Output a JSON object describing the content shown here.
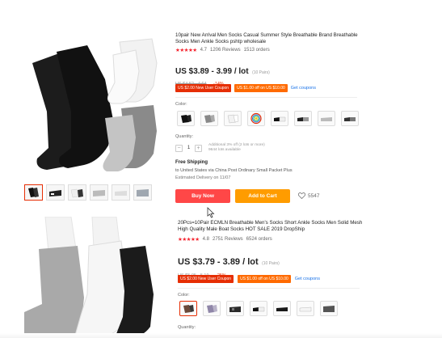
{
  "product1": {
    "title": "10pair New Arrival Men Socks Casual Summer Style Breathable Brand Breathable Socks Men Ankle Socks pshtp wholesale",
    "rating": "4.7",
    "reviews": "1206 Reviews",
    "orders": "1513 orders",
    "price": "US $3.89 - 3.99 / lot",
    "unit_note": "(10 Pairs)",
    "old_price": "US $4.52 - 4.64",
    "discount": "-14%",
    "coupon1": "US $2.00 New User Coupon",
    "coupon2": "US $1.00 off on US $10.00",
    "coupon_link": "Get coupons",
    "color_label": "Color:",
    "quantity_label": "Quantity:",
    "qty_minus": "−",
    "qty_value": "1",
    "qty_plus": "+",
    "qty_note_1": "Additional 3% off (2 lots or more)",
    "qty_note_2": "9644 lots available",
    "shipping_title": "Free Shipping",
    "shipping_text": "to United States via China Post Ordinary Small Packet Plus",
    "delivery": "Estimated Delivery on 11/07",
    "buy_now": "Buy Now",
    "add_to_cart": "Add to Cart",
    "wishlist_count": "5547"
  },
  "product2": {
    "title": "20Pcs=10Pair ECMLN Breathable Men's Socks Short Ankle Socks Men Solid Mesh High Quality Male Boat Socks HOT SALE 2019 DropShip",
    "rating": "4.8",
    "reviews": "2751 Reviews",
    "orders": "6524 orders",
    "price": "US $3.79 - 3.89 / lot",
    "unit_note": "(10 Pairs)",
    "old_price": "US $5.05 - 5.19",
    "discount": "-25%",
    "coupon1": "US $2.00 New User Coupon",
    "coupon2": "US $1.00 off on US $10.00",
    "coupon_link": "Get coupons",
    "color_label": "Color:",
    "quantity_label": "Quantity:"
  },
  "colors": {
    "accent": "#e62e04",
    "buy": "#ff4747",
    "cart": "#ff9c00",
    "link": "#1a73e8"
  }
}
